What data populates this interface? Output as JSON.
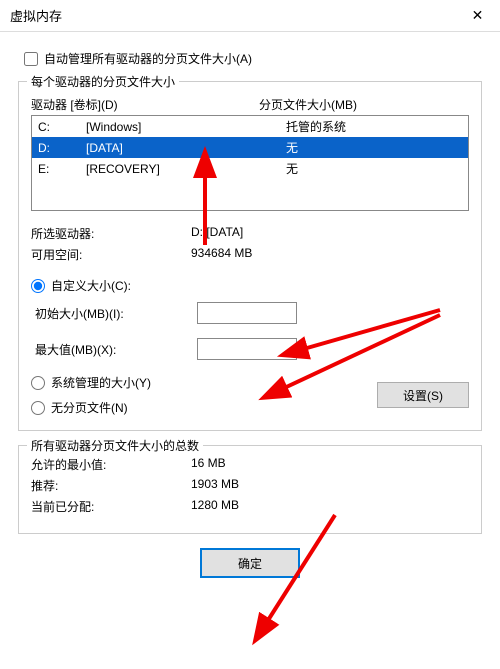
{
  "window": {
    "title": "虚拟内存"
  },
  "auto_manage": {
    "label": "自动管理所有驱动器的分页文件大小(A)"
  },
  "group1": {
    "title": "每个驱动器的分页文件大小",
    "header_drive": "驱动器 [卷标](D)",
    "header_size": "分页文件大小(MB)",
    "drives": [
      {
        "letter": "C:",
        "label": "[Windows]",
        "size": "托管的系统"
      },
      {
        "letter": "D:",
        "label": "[DATA]",
        "size": "无"
      },
      {
        "letter": "E:",
        "label": "[RECOVERY]",
        "size": "无"
      }
    ],
    "selected_index": 1,
    "selected_drive_label": "所选驱动器:",
    "selected_drive_value": "D:  [DATA]",
    "avail_label": "可用空间:",
    "avail_value": "934684 MB",
    "custom_radio": "自定义大小(C):",
    "initial_label": "初始大小(MB)(I):",
    "initial_value": "",
    "max_label": "最大值(MB)(X):",
    "max_value": "",
    "system_radio": "系统管理的大小(Y)",
    "none_radio": "无分页文件(N)",
    "set_button": "设置(S)"
  },
  "group2": {
    "title": "所有驱动器分页文件大小的总数",
    "min_label": "允许的最小值:",
    "min_value": "16 MB",
    "rec_label": "推荐:",
    "rec_value": "1903 MB",
    "cur_label": "当前已分配:",
    "cur_value": "1280 MB"
  },
  "footer": {
    "ok": "确定"
  }
}
